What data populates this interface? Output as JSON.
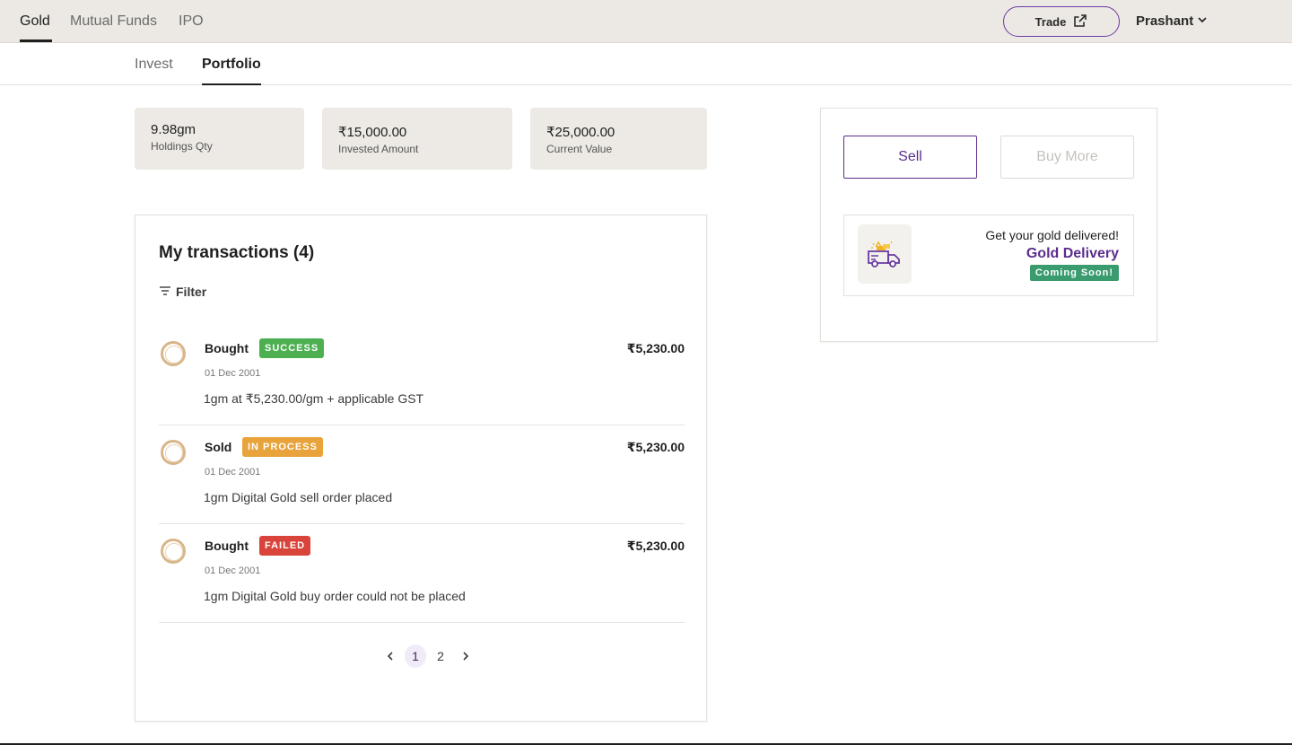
{
  "topnav": {
    "items": [
      {
        "label": "Gold",
        "active": true
      },
      {
        "label": "Mutual Funds",
        "active": false
      },
      {
        "label": "IPO",
        "active": false
      }
    ],
    "trade_label": "Trade",
    "user_name": "Prashant"
  },
  "subnav": {
    "items": [
      {
        "label": "Invest",
        "active": false
      },
      {
        "label": "Portfolio",
        "active": true
      }
    ]
  },
  "stats": [
    {
      "value": "9.98gm",
      "label": "Holdings Qty"
    },
    {
      "value": "₹15,000.00",
      "label": "Invested Amount"
    },
    {
      "value": "₹25,000.00",
      "label": "Current Value"
    }
  ],
  "transactions": {
    "title": "My transactions (4)",
    "filter_label": "Filter",
    "rows": [
      {
        "type": "Bought",
        "status": "SUCCESS",
        "status_color": "#4caf50",
        "date": "01 Dec 2001",
        "description": "1gm at ₹5,230.00/gm + applicable GST",
        "amount": "₹5,230.00"
      },
      {
        "type": "Sold",
        "status": "IN PROCESS",
        "status_color": "#e8a33a",
        "date": "01 Dec 2001",
        "description": "1gm Digital Gold sell order placed",
        "amount": "₹5,230.00"
      },
      {
        "type": "Bought",
        "status": "FAILED",
        "status_color": "#d9443a",
        "date": "01 Dec 2001",
        "description": "1gm Digital Gold buy order could not be placed",
        "amount": "₹5,230.00"
      }
    ],
    "pagination": {
      "pages": [
        "1",
        "2"
      ],
      "current": "1"
    }
  },
  "actions": {
    "sell_label": "Sell",
    "buy_more_label": "Buy More"
  },
  "delivery": {
    "subtitle": "Get your gold delivered!",
    "title": "Gold Delivery",
    "badge": "Coming Soon!"
  }
}
